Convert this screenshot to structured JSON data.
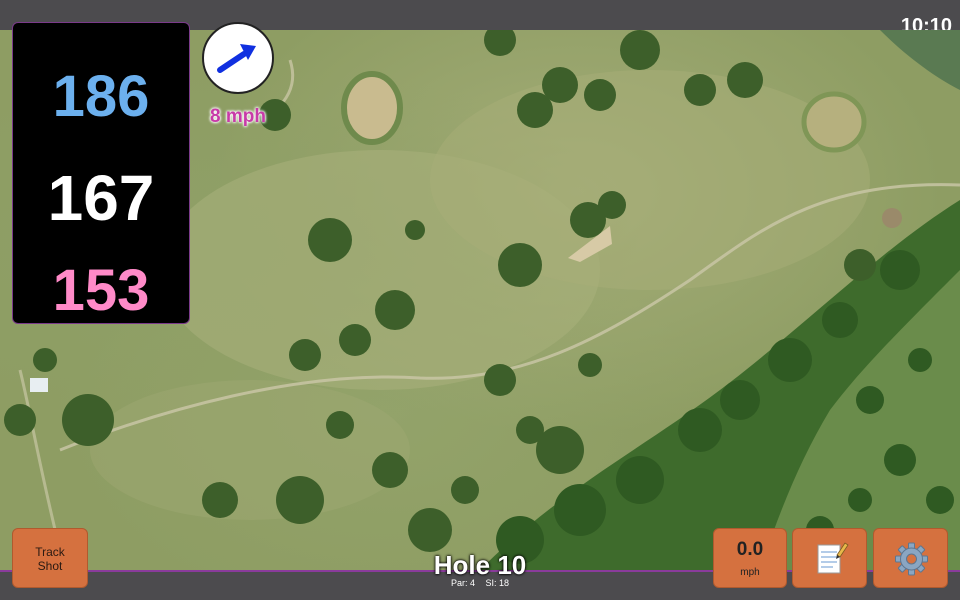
{
  "status": {
    "time": "10:10"
  },
  "yardages": {
    "back": "186",
    "middle": "167",
    "front": "153"
  },
  "wind": {
    "speed_label": "8 mph",
    "arrow_icon": "wind-arrow-icon",
    "arrow_color": "#1030e0"
  },
  "buttons": {
    "track_shot_line1": "Track",
    "track_shot_line2": "Shot",
    "speed_value": "0.0",
    "speed_unit": "mph",
    "notes_icon": "notepad-icon",
    "settings_icon": "gear-icon"
  },
  "hole": {
    "title": "Hole 10",
    "par": "Par: 4",
    "si": "SI: 18"
  },
  "colors": {
    "accent_button": "#d5713f",
    "back_yardage": "#6cb0ee",
    "middle_yardage": "#ffffff",
    "front_yardage": "#ff8ac8",
    "wind_speed": "#c83aa8",
    "bar_border": "#8a3b9b"
  }
}
